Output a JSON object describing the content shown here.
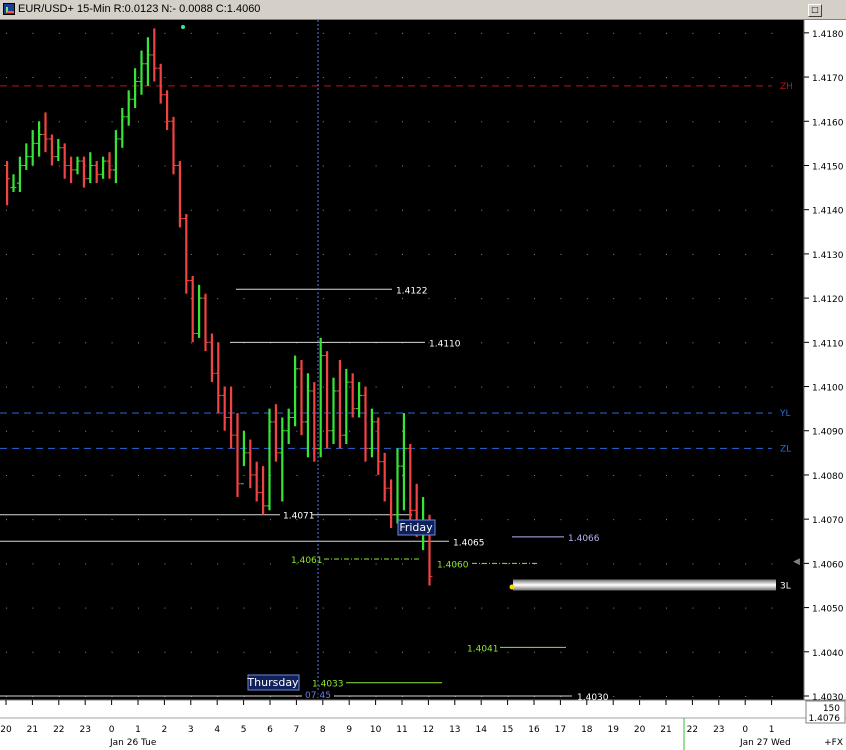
{
  "window": {
    "title": "EUR/USD+ 15-Min R:0.0123 N:- 0.0088 C:1.4060",
    "control": "□"
  },
  "colors": {
    "background": "#000000",
    "up_bar": "#35e635",
    "down_bar": "#f04444",
    "horizontal_line": "#d8d8d8",
    "green_level": "#8ce830",
    "zh_line": "#c01010",
    "blue_dashed": "#2a68d8",
    "crosshair": "#5a7adf",
    "axis_panel": "#ffffff"
  },
  "chart_data": {
    "type": "ohlc",
    "instrument": "EUR/USD+",
    "interval": "15-Min",
    "range": 0.0123,
    "net_change": "-0.0088",
    "close": 1.406,
    "ylim": [
      1.403,
      1.4182
    ],
    "y_ticks": [
      "1.4180",
      "1.4170",
      "1.4160",
      "1.4150",
      "1.4140",
      "1.4130",
      "1.4120",
      "1.4110",
      "1.4100",
      "1.4090",
      "1.4080",
      "1.4070",
      "1.4060",
      "1.4050",
      "1.4040",
      "1.4030"
    ],
    "x_tick_labels": [
      "20",
      "21",
      "22",
      "23",
      "0",
      "1",
      "2",
      "3",
      "4",
      "5",
      "6",
      "7",
      "8",
      "9",
      "10",
      "11",
      "12",
      "13",
      "14",
      "15",
      "16",
      "17",
      "18",
      "19",
      "20",
      "21",
      "22",
      "23",
      "0",
      "1"
    ],
    "x_date_labels": [
      "Jan 26 Tue",
      "Jan 27 Wed"
    ],
    "x_suffix": "+FX",
    "crosshair_label": "07:45",
    "bars": [
      {
        "o": 1.415,
        "h": 1.4151,
        "c": 1.4147,
        "l": 1.4141
      },
      {
        "o": 1.4145,
        "h": 1.4148,
        "c": 1.4145,
        "l": 1.4144
      },
      {
        "o": 1.4146,
        "h": 1.4152,
        "c": 1.415,
        "l": 1.4144
      },
      {
        "o": 1.415,
        "h": 1.4155,
        "c": 1.4152,
        "l": 1.4149
      },
      {
        "o": 1.4152,
        "h": 1.4158,
        "c": 1.4155,
        "l": 1.415
      },
      {
        "o": 1.4155,
        "h": 1.416,
        "c": 1.4157,
        "l": 1.4152
      },
      {
        "o": 1.4157,
        "h": 1.4162,
        "c": 1.4156,
        "l": 1.4153
      },
      {
        "o": 1.4156,
        "h": 1.4157,
        "c": 1.4152,
        "l": 1.415
      },
      {
        "o": 1.4152,
        "h": 1.4156,
        "c": 1.4154,
        "l": 1.4151
      },
      {
        "o": 1.4154,
        "h": 1.4155,
        "c": 1.415,
        "l": 1.4147
      },
      {
        "o": 1.415,
        "h": 1.4152,
        "c": 1.4149,
        "l": 1.4146
      },
      {
        "o": 1.4149,
        "h": 1.4152,
        "c": 1.4151,
        "l": 1.4148
      },
      {
        "o": 1.4151,
        "h": 1.4152,
        "c": 1.4147,
        "l": 1.4145
      },
      {
        "o": 1.4147,
        "h": 1.4153,
        "c": 1.415,
        "l": 1.4146
      },
      {
        "o": 1.415,
        "h": 1.4151,
        "c": 1.4148,
        "l": 1.4146
      },
      {
        "o": 1.4148,
        "h": 1.4152,
        "c": 1.4151,
        "l": 1.4147
      },
      {
        "o": 1.4151,
        "h": 1.4153,
        "c": 1.4149,
        "l": 1.4147
      },
      {
        "o": 1.4149,
        "h": 1.4158,
        "c": 1.4156,
        "l": 1.4146
      },
      {
        "o": 1.4156,
        "h": 1.4163,
        "c": 1.4161,
        "l": 1.4154
      },
      {
        "o": 1.4161,
        "h": 1.4167,
        "c": 1.4165,
        "l": 1.4159
      },
      {
        "o": 1.4165,
        "h": 1.4172,
        "c": 1.4169,
        "l": 1.4163
      },
      {
        "o": 1.4169,
        "h": 1.4176,
        "c": 1.4173,
        "l": 1.4166
      },
      {
        "o": 1.4173,
        "h": 1.4179,
        "c": 1.4175,
        "l": 1.4168
      },
      {
        "o": 1.4175,
        "h": 1.4181,
        "c": 1.4172,
        "l": 1.4169
      },
      {
        "o": 1.4172,
        "h": 1.4173,
        "c": 1.4166,
        "l": 1.4164
      },
      {
        "o": 1.4166,
        "h": 1.4167,
        "c": 1.416,
        "l": 1.4158
      },
      {
        "o": 1.416,
        "h": 1.4161,
        "c": 1.415,
        "l": 1.4148
      },
      {
        "o": 1.415,
        "h": 1.4151,
        "c": 1.4138,
        "l": 1.4136
      },
      {
        "o": 1.4138,
        "h": 1.4139,
        "c": 1.4124,
        "l": 1.4121
      },
      {
        "o": 1.4124,
        "h": 1.4125,
        "c": 1.4112,
        "l": 1.411
      },
      {
        "o": 1.4112,
        "h": 1.4123,
        "c": 1.412,
        "l": 1.4111
      },
      {
        "o": 1.412,
        "h": 1.4121,
        "c": 1.411,
        "l": 1.4108
      },
      {
        "o": 1.411,
        "h": 1.4112,
        "c": 1.4103,
        "l": 1.4101
      },
      {
        "o": 1.4103,
        "h": 1.411,
        "c": 1.4098,
        "l": 1.4094
      },
      {
        "o": 1.4098,
        "h": 1.41,
        "c": 1.4093,
        "l": 1.409
      },
      {
        "o": 1.4093,
        "h": 1.41,
        "c": 1.4089,
        "l": 1.4086
      },
      {
        "o": 1.4089,
        "h": 1.4094,
        "c": 1.4078,
        "l": 1.4075
      },
      {
        "o": 1.4078,
        "h": 1.409,
        "c": 1.4085,
        "l": 1.4082
      },
      {
        "o": 1.4085,
        "h": 1.4088,
        "c": 1.408,
        "l": 1.4077
      },
      {
        "o": 1.408,
        "h": 1.4083,
        "c": 1.4076,
        "l": 1.4074
      },
      {
        "o": 1.4076,
        "h": 1.4082,
        "c": 1.4073,
        "l": 1.4071
      },
      {
        "o": 1.4073,
        "h": 1.4095,
        "c": 1.4092,
        "l": 1.4072
      },
      {
        "o": 1.4092,
        "h": 1.4096,
        "c": 1.4085,
        "l": 1.4083
      },
      {
        "o": 1.4085,
        "h": 1.4093,
        "c": 1.409,
        "l": 1.4074
      },
      {
        "o": 1.409,
        "h": 1.4095,
        "c": 1.4093,
        "l": 1.4087
      },
      {
        "o": 1.4093,
        "h": 1.4107,
        "c": 1.4104,
        "l": 1.4091
      },
      {
        "o": 1.4104,
        "h": 1.4106,
        "c": 1.4092,
        "l": 1.4089
      },
      {
        "o": 1.4092,
        "h": 1.4103,
        "c": 1.4099,
        "l": 1.4084
      },
      {
        "o": 1.4099,
        "h": 1.4101,
        "c": 1.4086,
        "l": 1.4083
      },
      {
        "o": 1.4086,
        "h": 1.4111,
        "c": 1.4107,
        "l": 1.4084
      },
      {
        "o": 1.4107,
        "h": 1.4108,
        "c": 1.409,
        "l": 1.4086
      },
      {
        "o": 1.409,
        "h": 1.4102,
        "c": 1.4099,
        "l": 1.4087
      },
      {
        "o": 1.4099,
        "h": 1.4106,
        "c": 1.4089,
        "l": 1.4086
      },
      {
        "o": 1.4089,
        "h": 1.4104,
        "c": 1.4101,
        "l": 1.4087
      },
      {
        "o": 1.4101,
        "h": 1.4103,
        "c": 1.4095,
        "l": 1.4093
      },
      {
        "o": 1.4095,
        "h": 1.4101,
        "c": 1.4098,
        "l": 1.4093
      },
      {
        "o": 1.4098,
        "h": 1.41,
        "c": 1.4086,
        "l": 1.4083
      },
      {
        "o": 1.4086,
        "h": 1.4095,
        "c": 1.4092,
        "l": 1.4084
      },
      {
        "o": 1.4092,
        "h": 1.4093,
        "c": 1.4083,
        "l": 1.408
      },
      {
        "o": 1.4083,
        "h": 1.4085,
        "c": 1.4077,
        "l": 1.4074
      },
      {
        "o": 1.4077,
        "h": 1.4079,
        "c": 1.4071,
        "l": 1.4068
      },
      {
        "o": 1.4071,
        "h": 1.4086,
        "c": 1.4082,
        "l": 1.4069
      },
      {
        "o": 1.4082,
        "h": 1.4094,
        "c": 1.4086,
        "l": 1.4072
      },
      {
        "o": 1.4086,
        "h": 1.4087,
        "c": 1.4072,
        "l": 1.4067
      },
      {
        "o": 1.4072,
        "h": 1.4078,
        "c": 1.4069,
        "l": 1.4066
      },
      {
        "o": 1.4069,
        "h": 1.4075,
        "c": 1.4069,
        "l": 1.4063
      },
      {
        "o": 1.4069,
        "h": 1.4071,
        "c": 1.4057,
        "l": 1.4055
      }
    ],
    "levels": [
      {
        "label": "1.4122",
        "value": 1.4122,
        "style": "solid-white"
      },
      {
        "label": "1.4110",
        "value": 1.411,
        "style": "solid-white"
      },
      {
        "label": "1.4071",
        "value": 1.4071,
        "style": "solid-white"
      },
      {
        "label": "1.4065",
        "value": 1.4065,
        "style": "solid-white"
      },
      {
        "label": "1.4066",
        "value": 1.4066,
        "style": "solid-lavender"
      },
      {
        "label": "1.4061",
        "value": 1.4061,
        "style": "dashdot-green"
      },
      {
        "label": "1.4060",
        "value": 1.406,
        "style": "dashdot-green"
      },
      {
        "label": "1.4041",
        "value": 1.4041,
        "style": "solid-green"
      },
      {
        "label": "1.4033",
        "value": 1.4033,
        "style": "solid-green"
      },
      {
        "label": "1.4030",
        "value": 1.403,
        "style": "solid-white"
      },
      {
        "label": "ZH",
        "value": 1.4168,
        "style": "dashed-red"
      },
      {
        "label": "YL",
        "value": 1.4094,
        "style": "dashed-blue"
      },
      {
        "label": "ZL",
        "value": 1.4086,
        "style": "dashed-blue"
      },
      {
        "label": "3L",
        "value": 1.4055,
        "style": "gray-band"
      }
    ],
    "annotations": [
      "Friday",
      "Thursday"
    ],
    "status_values": [
      "150",
      "1.4076"
    ]
  }
}
